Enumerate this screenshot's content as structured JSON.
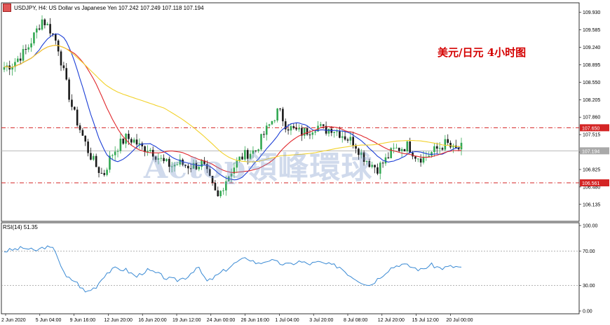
{
  "header": {
    "symbol_text": "USDJPY, H4:  US Dollar vs Japanese Yen  107.242 107.249 107.118 107.194"
  },
  "annotation": {
    "title_cn": "美元/日元  4小时图"
  },
  "watermark": {
    "text": "Actop領峰環球"
  },
  "rsi": {
    "label": "RSI(14) 51.35"
  },
  "colors": {
    "bull": "#32a852",
    "bear": "#1a1a1a",
    "ma_fast": "#1c3fd6",
    "ma_mid": "#e0282d",
    "ma_slow": "#f2d22c",
    "rsi": "#3a8ad4",
    "level": "#d42424",
    "current": "#b8b8b8"
  },
  "chart_data": [
    {
      "type": "candlestick",
      "title": "USDJPY, H4",
      "x_ticks": [
        "2 Jun 2020",
        "5 Jun 04:00",
        "9 Jun 16:00",
        "12 Jun 20:00",
        "16 Jun 20:00",
        "19 Jun 12:00",
        "24 Jun 00:00",
        "26 Jun 16:00",
        "1 Jul 04:00",
        "3 Jul 20:00",
        "8 Jul 08:00",
        "12 Jul 20:00",
        "15 Jul 12:00",
        "20 Jul 00:00"
      ],
      "y_ticks": [
        "109.930",
        "109.585",
        "109.240",
        "108.895",
        "108.550",
        "108.205",
        "107.860",
        "107.515",
        "107.170",
        "106.825",
        "106.480",
        "106.135"
      ],
      "ylim": [
        105.8,
        110.12
      ],
      "levels": [
        {
          "label": "107.650",
          "value": 107.65
        },
        {
          "label": "106.561",
          "value": 106.561
        }
      ],
      "current": {
        "label": "107.194",
        "value": 107.194
      },
      "close_path": [
        108.85,
        108.9,
        109.05,
        109.2,
        109.5,
        109.8,
        109.6,
        109.3,
        108.6,
        108.0,
        107.6,
        107.2,
        106.9,
        106.7,
        107.1,
        107.3,
        107.45,
        107.4,
        107.25,
        107.25,
        107.1,
        106.95,
        106.9,
        106.95,
        106.9,
        106.9,
        106.95,
        106.6,
        106.25,
        106.6,
        106.85,
        107.05,
        107.15,
        107.2,
        107.5,
        107.75,
        108.0,
        107.7,
        107.6,
        107.55,
        107.6,
        107.7,
        107.6,
        107.65,
        107.55,
        107.45,
        107.35,
        107.1,
        106.95,
        106.85,
        107.0,
        107.2,
        107.25,
        107.3,
        107.1,
        107.05,
        107.15,
        107.25,
        107.35,
        107.2,
        107.25
      ],
      "series": [
        {
          "name": "Fast MA",
          "color": "#1c3fd6"
        },
        {
          "name": "Mid MA",
          "color": "#e0282d"
        },
        {
          "name": "Slow MA",
          "color": "#f2d22c"
        }
      ]
    },
    {
      "type": "line",
      "title": "RSI(14)",
      "y_ticks": [
        "100.00",
        "70.00",
        "30.00",
        "0.00"
      ],
      "ylim": [
        0,
        100
      ],
      "levels": [
        70,
        30
      ],
      "last_value": 51.35,
      "key_points": [
        70,
        72,
        74,
        70,
        75,
        72,
        40,
        35,
        22,
        28,
        44,
        50,
        48,
        40,
        48,
        44,
        38,
        36,
        40,
        52,
        34,
        42,
        50,
        58,
        62,
        55,
        60,
        56,
        54,
        58,
        55,
        57,
        54,
        52,
        42,
        35,
        30,
        40,
        50,
        55,
        52,
        48,
        54,
        50,
        52,
        51.35
      ]
    }
  ]
}
